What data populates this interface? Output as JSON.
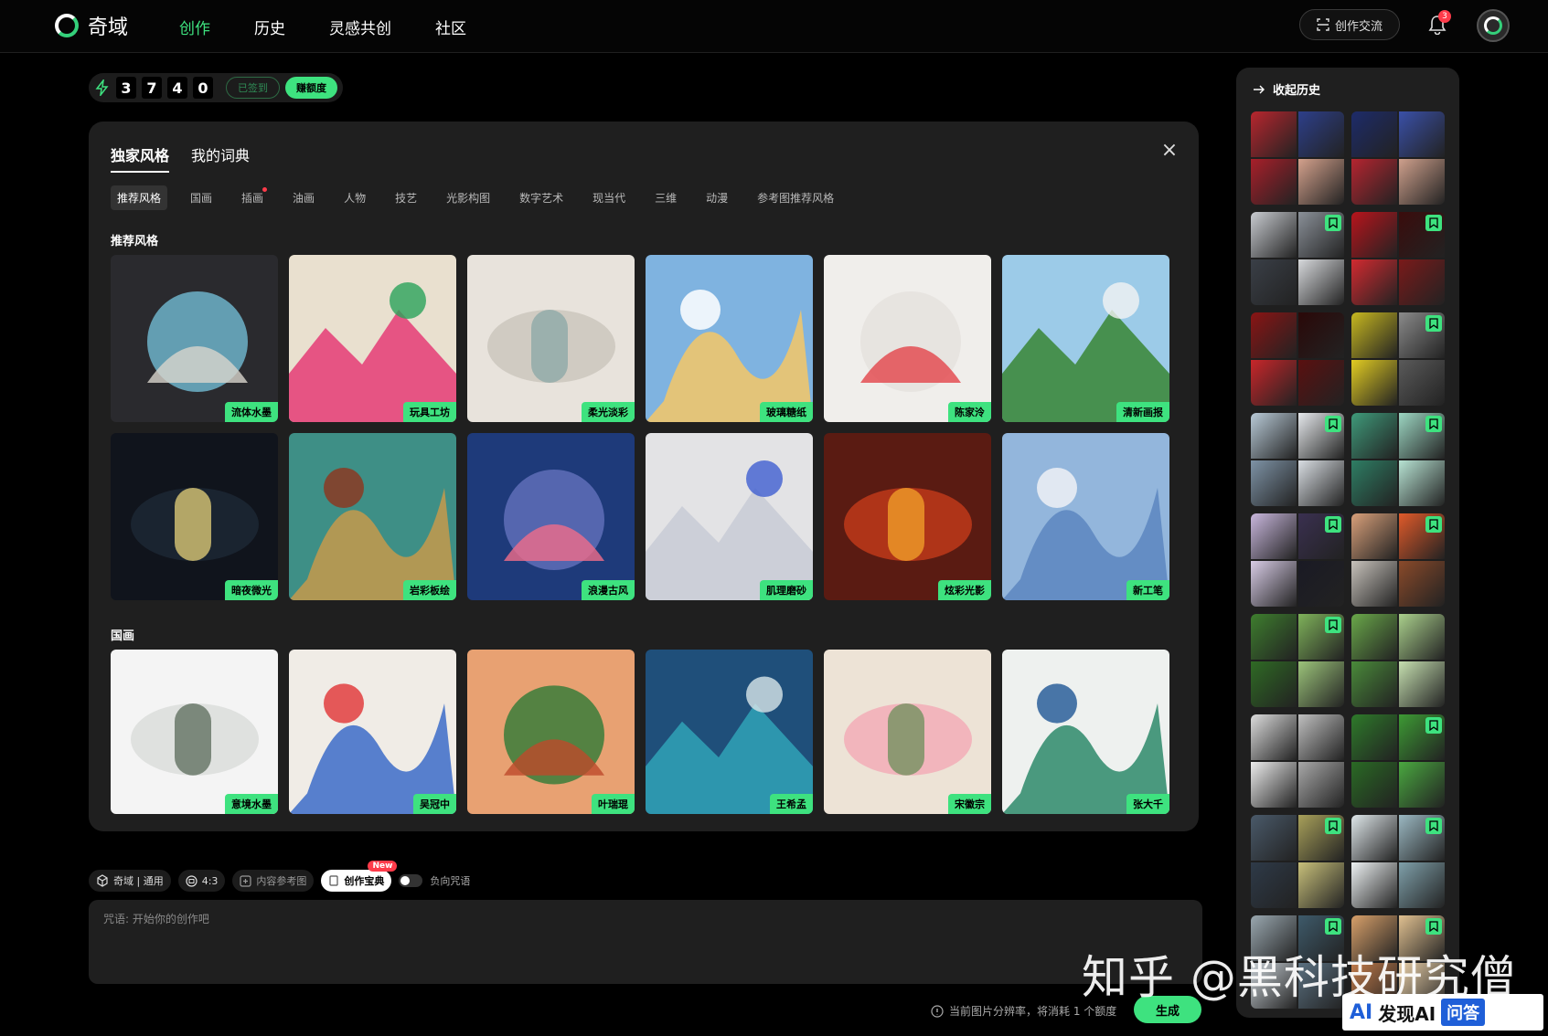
{
  "app": {
    "name": "奇域"
  },
  "nav": {
    "items": [
      "创作",
      "历史",
      "灵感共创",
      "社区"
    ],
    "active": 0
  },
  "header": {
    "exchange_label": "创作交流",
    "notification_count": "3"
  },
  "credits": {
    "digits": [
      "3",
      "7",
      "4",
      "0"
    ],
    "signed_label": "已签到",
    "earn_label": "赚额度"
  },
  "panel": {
    "tabs": [
      "独家风格",
      "我的词典"
    ],
    "categories": [
      "推荐风格",
      "国画",
      "插画",
      "油画",
      "人物",
      "技艺",
      "光影构图",
      "数字艺术",
      "现当代",
      "三维",
      "动漫",
      "参考图推荐风格"
    ],
    "recommended_title": "推荐风格",
    "recommended": [
      {
        "label": "流体水墨",
        "colors": [
          "#2a2a2e",
          "#6db3c9",
          "#d8d4cc"
        ]
      },
      {
        "label": "玩具工坊",
        "colors": [
          "#e9e0cf",
          "#e5457a",
          "#2aa25a"
        ]
      },
      {
        "label": "柔光淡彩",
        "colors": [
          "#e8e3dc",
          "#c9c4bc",
          "#8aa7a5"
        ]
      },
      {
        "label": "玻璃糖纸",
        "colors": [
          "#7fb3e0",
          "#f4c766",
          "#ffffff"
        ]
      },
      {
        "label": "陈家泠",
        "colors": [
          "#f0eeeb",
          "#e5e2de",
          "#e4434a"
        ]
      },
      {
        "label": "清新画报",
        "colors": [
          "#9ccbe8",
          "#3e8a3e",
          "#f3f3f3"
        ]
      },
      {
        "label": "暗夜微光",
        "colors": [
          "#10141c",
          "#1d2836",
          "#e7d27a"
        ]
      },
      {
        "label": "岩彩板绘",
        "colors": [
          "#3e8f86",
          "#c69a4b",
          "#8b3a22"
        ]
      },
      {
        "label": "浪漫古风",
        "colors": [
          "#1e3a7a",
          "#5f6fb8",
          "#f06d8a"
        ]
      },
      {
        "label": "肌理磨砂",
        "colors": [
          "#e3e3e5",
          "#c9ccd6",
          "#3f5ed1"
        ]
      },
      {
        "label": "炫彩光影",
        "colors": [
          "#5a1b12",
          "#c43b1a",
          "#f4a32a"
        ]
      },
      {
        "label": "新工笔",
        "colors": [
          "#93b6dc",
          "#5c86c0",
          "#eef1f6"
        ]
      }
    ],
    "guohua_title": "国画",
    "guohua": [
      {
        "label": "意境水墨",
        "colors": [
          "#f4f4f4",
          "#d9dcd9",
          "#5a6a5a"
        ]
      },
      {
        "label": "吴冠中",
        "colors": [
          "#f0ece6",
          "#3c6cc8",
          "#e23e3e"
        ]
      },
      {
        "label": "叶瑞琨",
        "colors": [
          "#e8a172",
          "#3a7d3a",
          "#bd4a2a"
        ]
      },
      {
        "label": "王希孟",
        "colors": [
          "#1f4f7a",
          "#2f9db4",
          "#d8e6ea"
        ]
      },
      {
        "label": "宋徽宗",
        "colors": [
          "#ede3d6",
          "#f2a9b5",
          "#6b8f5a"
        ]
      },
      {
        "label": "张大千",
        "colors": [
          "#eef1ef",
          "#2d8a6a",
          "#2a5f9a"
        ]
      }
    ]
  },
  "toolbar": {
    "model_label": "奇域 | 通用",
    "ratio_label": "4:3",
    "ref_label": "内容参考图",
    "book_label": "创作宝典",
    "new_badge": "New",
    "negative_label": "负向咒语"
  },
  "prompt": {
    "placeholder": "咒语: 开始你的创作吧"
  },
  "footer": {
    "cost_note": "当前图片分辨率，将消耗 1 个额度",
    "generate_label": "生成"
  },
  "history": {
    "title": "收起历史",
    "items": [
      {
        "colors": [
          "#b8262e",
          "#2d3f8a",
          "#a81f2a",
          "#d4a18c"
        ],
        "bookmarked": false
      },
      {
        "colors": [
          "#1d2b6a",
          "#3a50a8",
          "#b52530",
          "#cfa08c"
        ],
        "bookmarked": false
      },
      {
        "colors": [
          "#c9ccd1",
          "#8a9098",
          "#3a3f47",
          "#d7d9dc"
        ],
        "bookmarked": true
      },
      {
        "colors": [
          "#b8141c",
          "#3a0c0c",
          "#d22a30",
          "#7a1a1a"
        ],
        "bookmarked": true
      },
      {
        "colors": [
          "#8a1414",
          "#2a0808",
          "#c8262a",
          "#5a1010"
        ],
        "bookmarked": false
      },
      {
        "colors": [
          "#c8b820",
          "#8a8a8a",
          "#e2cc22",
          "#5a5a5a"
        ],
        "bookmarked": true
      },
      {
        "colors": [
          "#b9cbd8",
          "#e6e9ec",
          "#7e93a6",
          "#d9dee3"
        ],
        "bookmarked": true
      },
      {
        "colors": [
          "#3f9a7a",
          "#9cd6c2",
          "#2e7e64",
          "#b7e3d3"
        ],
        "bookmarked": true
      },
      {
        "colors": [
          "#c9b7dd",
          "#3a3050",
          "#d8cce6",
          "#1a1a24"
        ],
        "bookmarked": true
      },
      {
        "colors": [
          "#d9a07a",
          "#e05a2a",
          "#c7c2bb",
          "#8a4a2a"
        ],
        "bookmarked": true
      },
      {
        "colors": [
          "#3e7e2e",
          "#7fb25a",
          "#2f6a24",
          "#9cc47a"
        ],
        "bookmarked": true
      },
      {
        "colors": [
          "#6aa84a",
          "#aad08c",
          "#4a8a3a",
          "#c6e0b0"
        ],
        "bookmarked": false
      },
      {
        "colors": [
          "#dcdcdc",
          "#bfbfbf",
          "#ececec",
          "#a8a8a8"
        ],
        "bookmarked": false
      },
      {
        "colors": [
          "#2e7a2a",
          "#3d9a34",
          "#2a6a24",
          "#4aa840"
        ],
        "bookmarked": true
      },
      {
        "colors": [
          "#4a5a6a",
          "#a8a05a",
          "#2e3a48",
          "#c8c07a"
        ],
        "bookmarked": true
      },
      {
        "colors": [
          "#dfe7ea",
          "#9bb8c2",
          "#eef2f3",
          "#7fa0aa"
        ],
        "bookmarked": true
      },
      {
        "colors": [
          "#9aa8b0",
          "#3e5a6a",
          "#c8d0d6",
          "#5a7080"
        ],
        "bookmarked": true
      },
      {
        "colors": [
          "#d8a06a",
          "#e0c090",
          "#c07a4a",
          "#ead0a8"
        ],
        "bookmarked": true
      }
    ]
  },
  "watermark": {
    "text": "知乎 @黑科技研究僧",
    "logo_ai": "AI",
    "logo_text": "发现AI",
    "logo_box": "问答"
  }
}
